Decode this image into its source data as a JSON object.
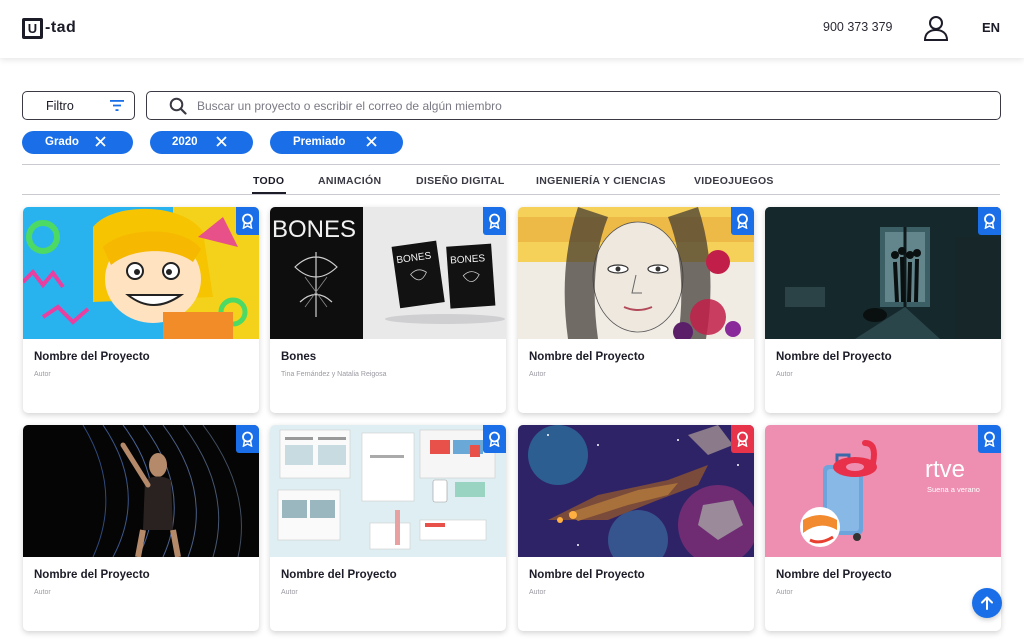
{
  "header": {
    "logo_box": "U",
    "logo_text": "-tad",
    "phone": "900 373 379",
    "lang": "EN"
  },
  "filter": {
    "label": "Filtro"
  },
  "search": {
    "placeholder": "Buscar un proyecto o escribir el correo de algún miembro"
  },
  "chips": [
    {
      "label": "Grado"
    },
    {
      "label": "2020"
    },
    {
      "label": "Premiado"
    }
  ],
  "tabs": [
    {
      "label": "TODO",
      "active": true
    },
    {
      "label": "ANIMACIÓN"
    },
    {
      "label": "DISEÑO DIGITAL"
    },
    {
      "label": "INGENIERÍA Y CIENCIAS"
    },
    {
      "label": "VIDEOJUEGOS"
    }
  ],
  "cards": [
    {
      "title": "Nombre del Proyecto",
      "author": "Autor",
      "image": "cartoon-girl",
      "badge_color": "#1a6fe8"
    },
    {
      "title": "Bones",
      "author": "Tina Fernández y Natalia Reigosa",
      "image": "bones-poster",
      "badge_color": "#1a6fe8",
      "image_text": "BONES"
    },
    {
      "title": "Nombre del Proyecto",
      "author": "Autor",
      "image": "woman-illustration",
      "badge_color": "#1a6fe8"
    },
    {
      "title": "Nombre del Proyecto",
      "author": "Autor",
      "image": "dark-room",
      "badge_color": "#1a6fe8"
    },
    {
      "title": "Nombre del Proyecto",
      "author": "Autor",
      "image": "dancer",
      "badge_color": "#1a6fe8"
    },
    {
      "title": "Nombre del Proyecto",
      "author": "Autor",
      "image": "stationery-mockup",
      "badge_color": "#1a6fe8"
    },
    {
      "title": "Nombre del Proyecto",
      "author": "Autor",
      "image": "spaceship",
      "badge_color": "#e8344a"
    },
    {
      "title": "Nombre del Proyecto",
      "author": "Autor",
      "image": "rtve-suitcase",
      "badge_color": "#1a6fe8",
      "image_text": "rtve",
      "image_subtext": "Suena a verano"
    }
  ],
  "colors": {
    "accent": "#1a6fe8",
    "badge_red": "#e8344a",
    "text_dark": "#1c1c28"
  }
}
